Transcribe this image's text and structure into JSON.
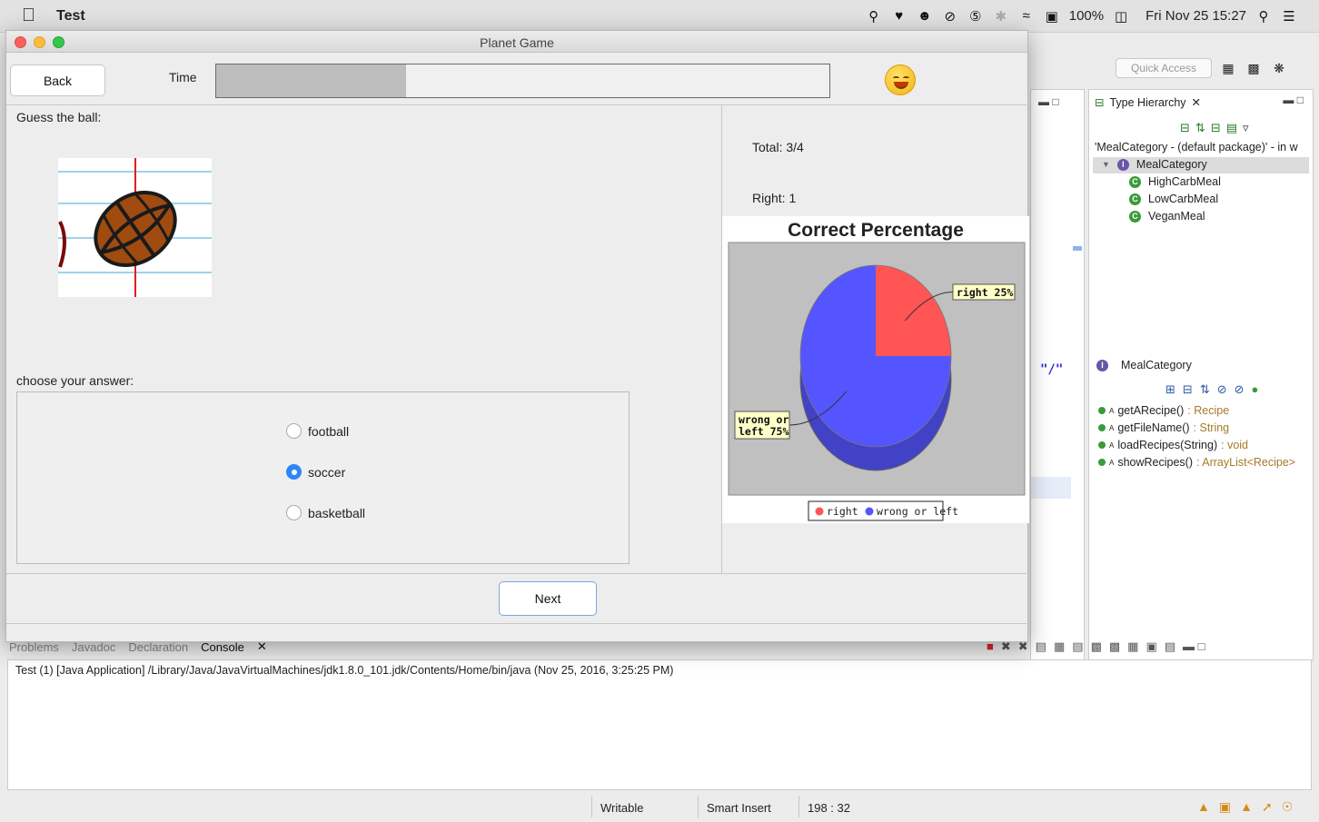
{
  "menubar": {
    "app_name": "Test",
    "battery": "100%",
    "clock": "Fri Nov 25  15:27"
  },
  "ide": {
    "quick_access": "Quick Access",
    "editor_text": "\"/\"",
    "type_hierarchy": {
      "title": "Type Hierarchy",
      "description": "'MealCategory - (default package)' - in w",
      "root": "MealCategory",
      "children": [
        "HighCarbMeal",
        "LowCarbMeal",
        "VeganMeal"
      ],
      "members_title": "MealCategory",
      "members": [
        {
          "name": "getARecipe()",
          "type": ": Recipe"
        },
        {
          "name": "getFileName()",
          "type": ": String"
        },
        {
          "name": "loadRecipes(String)",
          "type": ": void"
        },
        {
          "name": "showRecipes()",
          "type": ": ArrayList<Recipe>"
        }
      ]
    },
    "console_tabs": [
      "Problems",
      "Javadoc",
      "Declaration",
      "Console"
    ],
    "console_line": "Test (1) [Java Application] /Library/Java/JavaVirtualMachines/jdk1.8.0_101.jdk/Contents/Home/bin/java (Nov 25, 2016, 3:25:25 PM)",
    "status": {
      "writable": "Writable",
      "insert": "Smart Insert",
      "position": "198 : 32"
    }
  },
  "game": {
    "window_title": "Planet Game",
    "back_label": "Back",
    "time_label": "Time",
    "time_progress": 0.31,
    "guess_label": "Guess the ball:",
    "choose_label": "choose your answer:",
    "options": [
      {
        "label": "football",
        "selected": false
      },
      {
        "label": "soccer",
        "selected": true
      },
      {
        "label": "basketball",
        "selected": false
      }
    ],
    "next_label": "Next",
    "total": "Total: 3/4",
    "right": "Right: 1"
  },
  "chart_data": {
    "type": "pie",
    "title": "Correct Percentage",
    "categories": [
      "right",
      "wrong or left"
    ],
    "values": [
      25,
      75
    ],
    "slice_labels": [
      "right  25%",
      "wrong or left  75%"
    ],
    "colors": [
      "#ff5555",
      "#5555ff"
    ],
    "background": "#c0c0c0",
    "legend": [
      "right",
      "wrong or left"
    ],
    "legend_position": "bottom"
  }
}
